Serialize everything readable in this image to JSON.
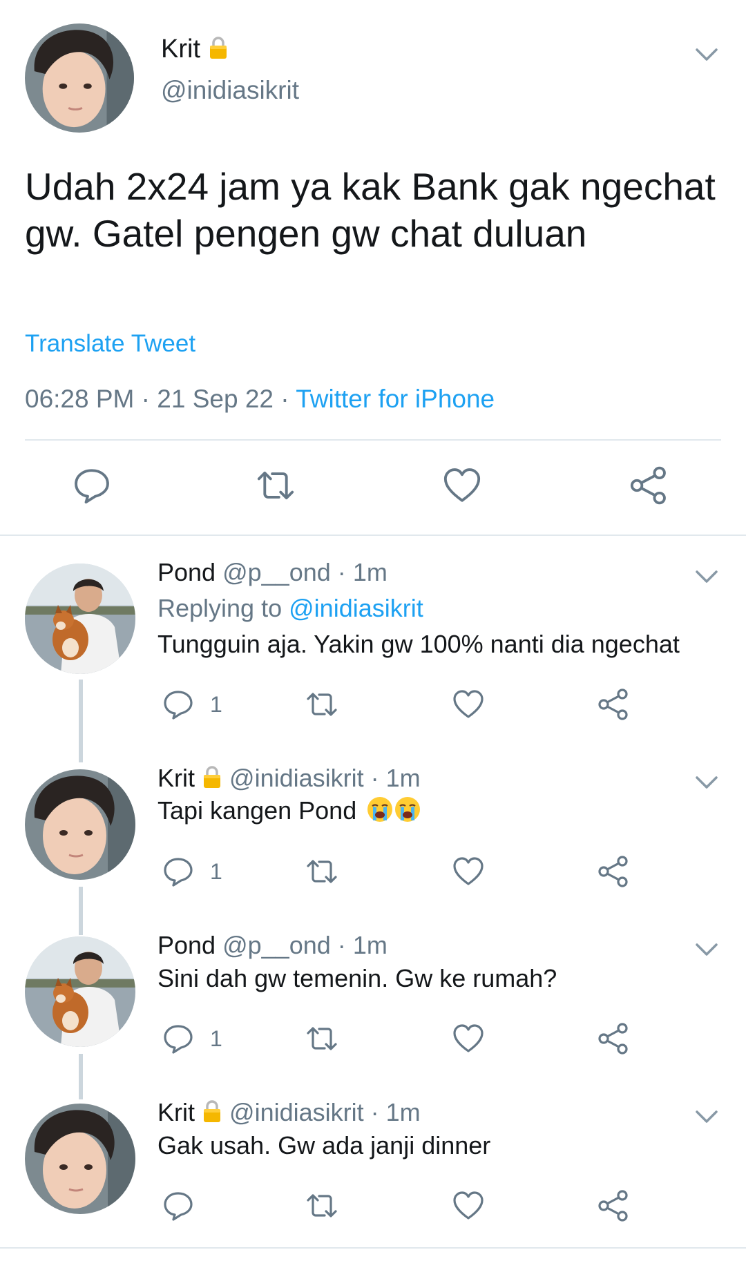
{
  "main_tweet": {
    "name": "Krit",
    "handle": "@inidiasikrit",
    "text": "Udah 2x24 jam ya kak Bank gak ngechat gw. Gatel pengen gw chat duluan",
    "translate_label": "Translate Tweet",
    "time": "06:28 PM",
    "date": "21 Sep 22",
    "separator": "·",
    "source": "Twitter for iPhone"
  },
  "replies": [
    {
      "name": "Pond",
      "handle": "@p__ond",
      "time": "1m",
      "replying_prefix": "Replying to",
      "replying_to": "@inidiasikrit",
      "text": "Tungguin aja. Yakin gw 100% nanti dia ngechat",
      "reply_count": "1"
    },
    {
      "name": "Krit",
      "handle": "@inidiasikrit",
      "time": "1m",
      "text": "Tapi kangen Pond",
      "reply_count": "1"
    },
    {
      "name": "Pond",
      "handle": "@p__ond",
      "time": "1m",
      "text": "Sini dah gw temenin. Gw ke rumah?",
      "reply_count": "1"
    },
    {
      "name": "Krit",
      "handle": "@inidiasikrit",
      "time": "1m",
      "text": "Gak usah. Gw ada janji dinner"
    }
  ],
  "colors": {
    "link": "#1da1f2",
    "secondary_text": "#657786",
    "divider": "#e1e8ed",
    "thread_line": "#ccd6dd"
  },
  "icons": [
    "chevron-down-icon",
    "lock-icon",
    "reply-icon",
    "retweet-icon",
    "like-icon",
    "share-icon",
    "crying-face-emoji"
  ]
}
